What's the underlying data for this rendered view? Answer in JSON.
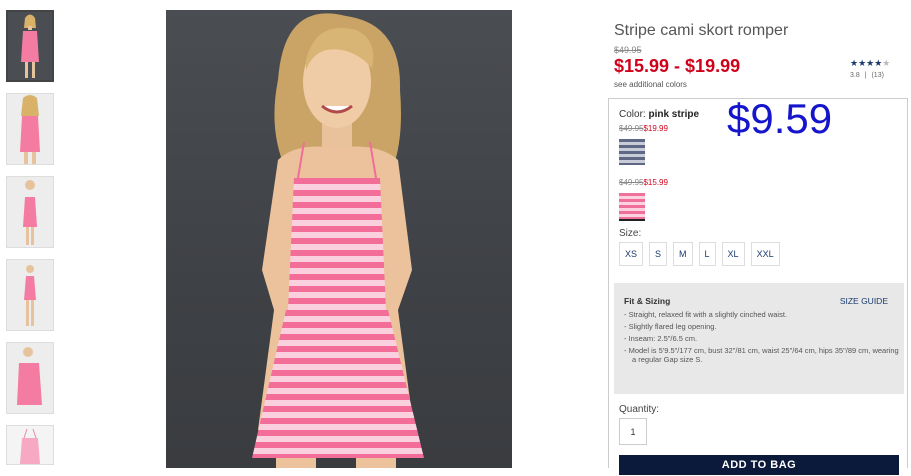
{
  "product": {
    "title": "Stripe cami skort romper",
    "original_price": "$49.95",
    "price_range": "$15.99 - $19.99",
    "see_colors": "see additional colors",
    "rating_stars": "★★★★",
    "rating_empty_star": "★",
    "rating_value": "3.8",
    "rating_sep": "|",
    "rating_count": "(13)"
  },
  "color": {
    "label": "Color:",
    "selected": "pink stripe",
    "highlight_price": "$9.59",
    "swatches": [
      {
        "name": "blue stripe",
        "original": "$49.95",
        "price": "$19.99"
      },
      {
        "name": "pink stripe",
        "original": "$49.95",
        "price": "$15.99"
      }
    ]
  },
  "size": {
    "label": "Size:",
    "options": [
      "XS",
      "S",
      "M",
      "L",
      "XL",
      "XXL"
    ]
  },
  "fit": {
    "title": "Fit & Sizing",
    "guide": "SIZE GUIDE",
    "items": [
      "- Straight, relaxed fit with a slightly cinched waist.",
      "- Slightly flared leg opening.",
      "- Inseam: 2.5\"/6.5 cm.",
      "- Model is 5'9.5\"/177 cm, bust 32\"/81 cm, waist 25\"/64 cm, hips 35\"/89 cm, wearing a regular Gap size S."
    ]
  },
  "quantity": {
    "label": "Quantity:",
    "value": "1"
  },
  "cta": {
    "add_to_bag": "ADD TO BAG"
  },
  "colors": {
    "sale": "#d0021b",
    "link": "#1a3a6e",
    "highlight": "#1515cc",
    "cta_bg": "#0b1a3a"
  }
}
